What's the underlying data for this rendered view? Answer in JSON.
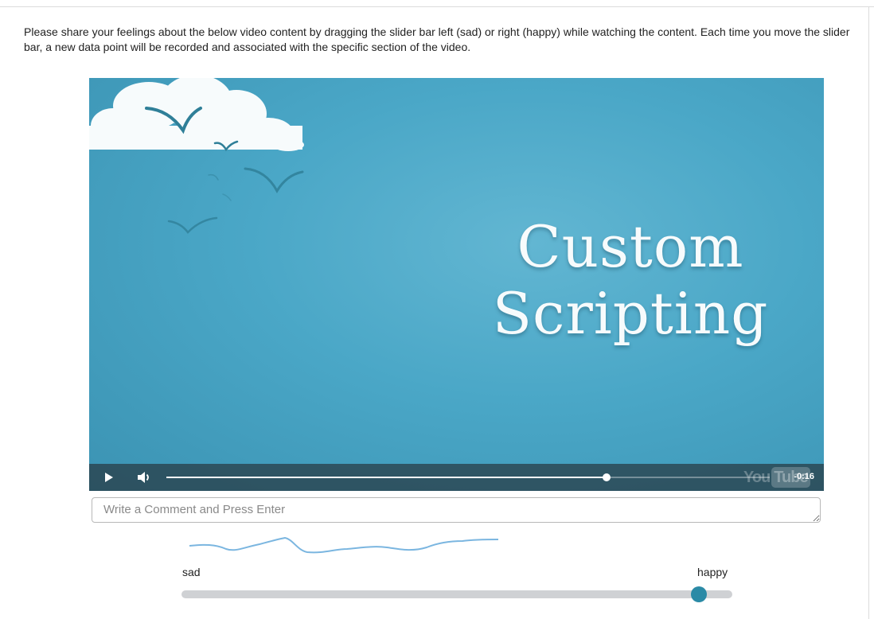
{
  "instructions": "Please share your feelings about the below video content by dragging the slider bar left (sad) or right (happy) while watching the content. Each time you move the slider bar, a new data point will be recorded and associated with the specific section of the video.",
  "video": {
    "title_line1": "Custom",
    "title_line2": "Scripting",
    "time_remaining": "-0:16",
    "progress_fraction": 0.73,
    "logo_you": "You",
    "logo_tube": "Tube",
    "bg_color": "#4aa7c7"
  },
  "comment": {
    "placeholder": "Write a Comment and Press Enter",
    "value": ""
  },
  "slider": {
    "left_label": "sad",
    "right_label": "happy",
    "value_fraction": 0.94,
    "accent_color": "#2b8aa6"
  },
  "icons": {
    "play": "play-icon",
    "volume": "volume-icon"
  }
}
